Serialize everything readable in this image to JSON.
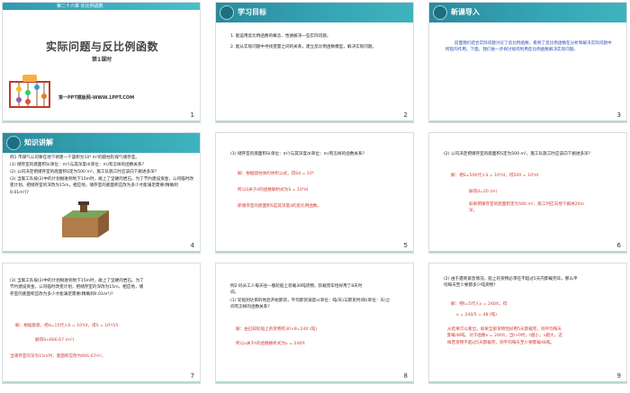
{
  "slides": [
    {
      "number": "1",
      "topbar": "第二十六章  反比例函数",
      "title": "实际问题与反比例函数",
      "subtitle": "第1课时",
      "footer": "第一PPT模板网-WWW.1PPT.COM"
    },
    {
      "number": "2",
      "header": "学习目标",
      "items": [
        "1. 能运用反比例函数的概念、性质解决一些实际问题。",
        "2. 能从实际问题中寻找变量之间的关系，建立反比例函数模型，解决实际问题。"
      ]
    },
    {
      "number": "3",
      "header": "新课导入",
      "body": "前面我们结合实际问题讨论了反比例函数，看到了反比例函数在分析和解决实际问题中所起的作用。下面，我们进一步探讨如何利用反比例函数解决实际问题。"
    },
    {
      "number": "4",
      "header": "知识讲解",
      "lines": [
        "例1 市煤气公司要在地下修建一个容积为10⁴ m³的圆柱形煤气储存室。",
        "(1) 储存室的底面积S(单位：m²)与其深度d(单位：m)有怎样的函数关系?",
        "(2) 公司决定把储存室的底面积S定为500 m²，施工队施工时应该向下掘进多深?",
        "(3) 当施工队按(2)中的计划掘进到地下15m时，碰上了坚硬的岩石。为了节约建设资金，公司临时改变计划，把储存室的深改为15m，相应地，储存室的底面积应改为多少才能满足需要(精确到0.01m²)?"
      ]
    },
    {
      "number": "5",
      "lines": [
        "(1) 储存室的底面积S(单位：m²)与其深度d(单位：m)有怎样的函数关系?"
      ],
      "answer": [
        "解：根据圆柱体的体积公式，得Sd = 10⁴",
        "所以S关于d的函数解析式为S = 10⁴/d",
        "即储存室的底面积S是其深度d的反比例函数。"
      ]
    },
    {
      "number": "6",
      "lines": [
        "(2) 公司决定把储存室的底面积S定为500 m²，施工队施工时应该向下掘进多深?"
      ],
      "answer": [
        "解：把S=500代入S = 10⁴/d，得500 = 10⁴/d",
        "解得d=20 (m)",
        "如果把储存室的底面积定为500 m²，施工时应向地下掘进20m深。"
      ]
    },
    {
      "number": "7",
      "lines": [
        "(3) 当施工队按(2)中的计划掘进到地下15m时，碰上了坚硬的岩石。为了节约建设资金，公司临时改变计划，把储存室的深改为15m，相应地，储存室的底面积应改为多少才能满足需要(精确到0.01m²)?"
      ],
      "answer": [
        "解：根据题意，把d=15代入S = 10⁴/d，得S = 10⁴/15",
        "解得S≈666.67 (m²)",
        "当储存室的深为15m时，底面积应改为666.67m²。"
      ]
    },
    {
      "number": "8",
      "lines": [
        "例2 码头工人每天往一艘轮船上装载30吨货物，装载完毕恰好用了8天时间。",
        "(1) 轮船到达目的地后开始卸货，平均卸货速度v(单位：吨/天)与卸货时间t(单位：天)之间有怎样的函数关系?"
      ],
      "answer": [
        "解：由已知轮船上的货物有30×8=240 (吨)",
        "所以v关于t的函数解析式为v = 240/t"
      ]
    },
    {
      "number": "9",
      "lines": [
        "(2) 由于遇到紧急情况，船上的货物必须在不超过5天内卸载完毕，那么平均每天至少要卸多少吨货物?"
      ],
      "answer": [
        "解：把t=5代入v = 240/t，得",
        "v = 240/5 = 48 (吨)",
        "从结果可以看出，如果全部货物恰好用5天卸载完，则平均每天卸载48吨。对于函数v = 240/t，当t>0时，t越小，v越大。这样若货物不超过5天卸载完，则平均每天至少要卸载48吨。"
      ]
    }
  ],
  "colors": {
    "header_teal": "#2b8a9e",
    "answer_red": "#d03a2f",
    "answer_blue": "#2a4fb4",
    "title_gray": "#444444"
  }
}
